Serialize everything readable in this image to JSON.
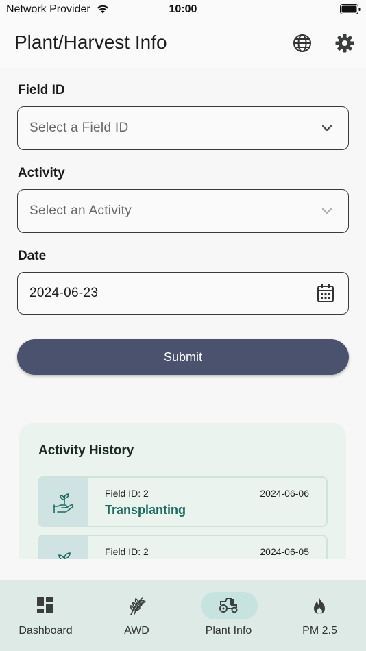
{
  "status_bar": {
    "carrier": "Network Provider",
    "time": "10:00"
  },
  "header": {
    "title": "Plant/Harvest Info",
    "language_icon": "globe-icon",
    "settings_icon": "gear-icon"
  },
  "form": {
    "field_id": {
      "label": "Field ID",
      "placeholder": "Select a Field ID"
    },
    "activity": {
      "label": "Activity",
      "placeholder": "Select an Activity"
    },
    "date": {
      "label": "Date",
      "value": "2024-06-23"
    },
    "submit_label": "Submit"
  },
  "history": {
    "title": "Activity History",
    "items": [
      {
        "field_id": "Field ID: 2",
        "date": "2024-06-06",
        "activity": "Transplanting",
        "icon": "seedling-hand-icon"
      },
      {
        "field_id": "Field ID: 2",
        "date": "2024-06-05",
        "activity": "",
        "icon": "sprout-icon"
      }
    ]
  },
  "nav": [
    {
      "label": "Dashboard",
      "icon": "dashboard-icon",
      "active": false
    },
    {
      "label": "AWD",
      "icon": "wheat-icon",
      "active": false
    },
    {
      "label": "Plant Info",
      "icon": "tractor-icon",
      "active": true
    },
    {
      "label": "PM 2.5",
      "icon": "fire-icon",
      "active": false
    }
  ],
  "colors": {
    "primary_button": "#4a526d",
    "accent_text": "#1b6b5f",
    "nav_background": "#ddeae6",
    "active_pill": "#c6e3e0"
  }
}
